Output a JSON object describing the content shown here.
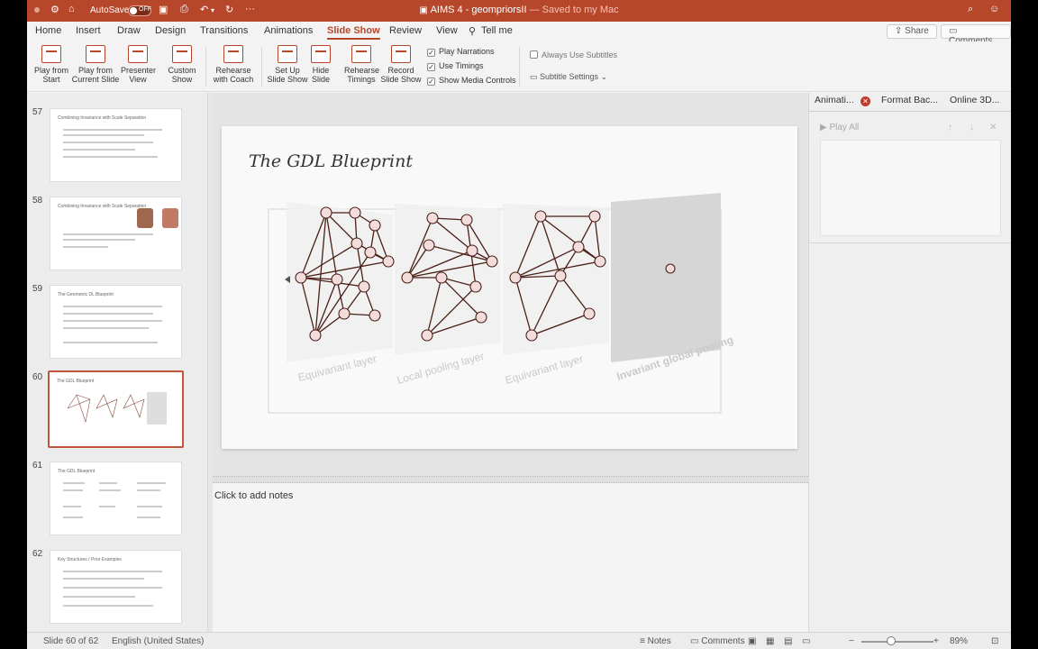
{
  "titlebar": {
    "autosave_label": "AutoSave",
    "autosave_state": "OFF",
    "doc_name": "AIMS 4 - geompriorsII",
    "doc_status": "— Saved to my Mac"
  },
  "tabs": [
    "Home",
    "Insert",
    "Draw",
    "Design",
    "Transitions",
    "Animations",
    "Slide Show",
    "Review",
    "View"
  ],
  "tell_me": "Tell me",
  "share_label": "Share",
  "comments_label": "Comments",
  "ribbon": {
    "play_from_start": [
      "Play from",
      "Start"
    ],
    "play_from_current": [
      "Play from",
      "Current Slide"
    ],
    "presenter_view": [
      "Presenter",
      "View"
    ],
    "custom_show": [
      "Custom",
      "Show"
    ],
    "rehearse_coach": [
      "Rehearse",
      "with Coach"
    ],
    "setup_show": [
      "Set Up",
      "Slide Show"
    ],
    "hide_slide": [
      "Hide",
      "Slide"
    ],
    "rehearse_timings": [
      "Rehearse",
      "Timings"
    ],
    "record_show": [
      "Record",
      "Slide Show"
    ],
    "play_narrations": "Play Narrations",
    "use_timings": "Use Timings",
    "show_media_controls": "Show Media Controls",
    "always_subtitles": "Always Use Subtitles",
    "subtitle_settings": "Subtitle Settings"
  },
  "thumbnails": [
    {
      "num": "57",
      "title": "Combining Invariance with Scale Separation"
    },
    {
      "num": "58",
      "title": "Combining Invariance with Scale Separation"
    },
    {
      "num": "59",
      "title": "The Geometric DL Blueprint"
    },
    {
      "num": "60",
      "title": "The GDL Blueprint"
    },
    {
      "num": "61",
      "title": "The GDL Blueprint"
    },
    {
      "num": "62",
      "title": "Key Structures / Prior Examples"
    }
  ],
  "slide": {
    "title": "The GDL Blueprint",
    "labels": [
      "Equivariant layer",
      "Local pooling layer",
      "Equivariant layer",
      "Invariant global pooling"
    ]
  },
  "notes_placeholder": "Click to add notes",
  "right_pane": {
    "tabs": [
      "Animati...",
      "Format Bac...",
      "Online 3D..."
    ],
    "play_all": "Play All"
  },
  "status": {
    "slide_pos": "Slide 60 of 62",
    "language": "English (United States)",
    "notes": "Notes",
    "comments": "Comments",
    "zoom": "89%"
  },
  "colors": {
    "accent": "#b7472a",
    "node_fill": "#f3dcdc",
    "edge": "#4a1f16"
  }
}
